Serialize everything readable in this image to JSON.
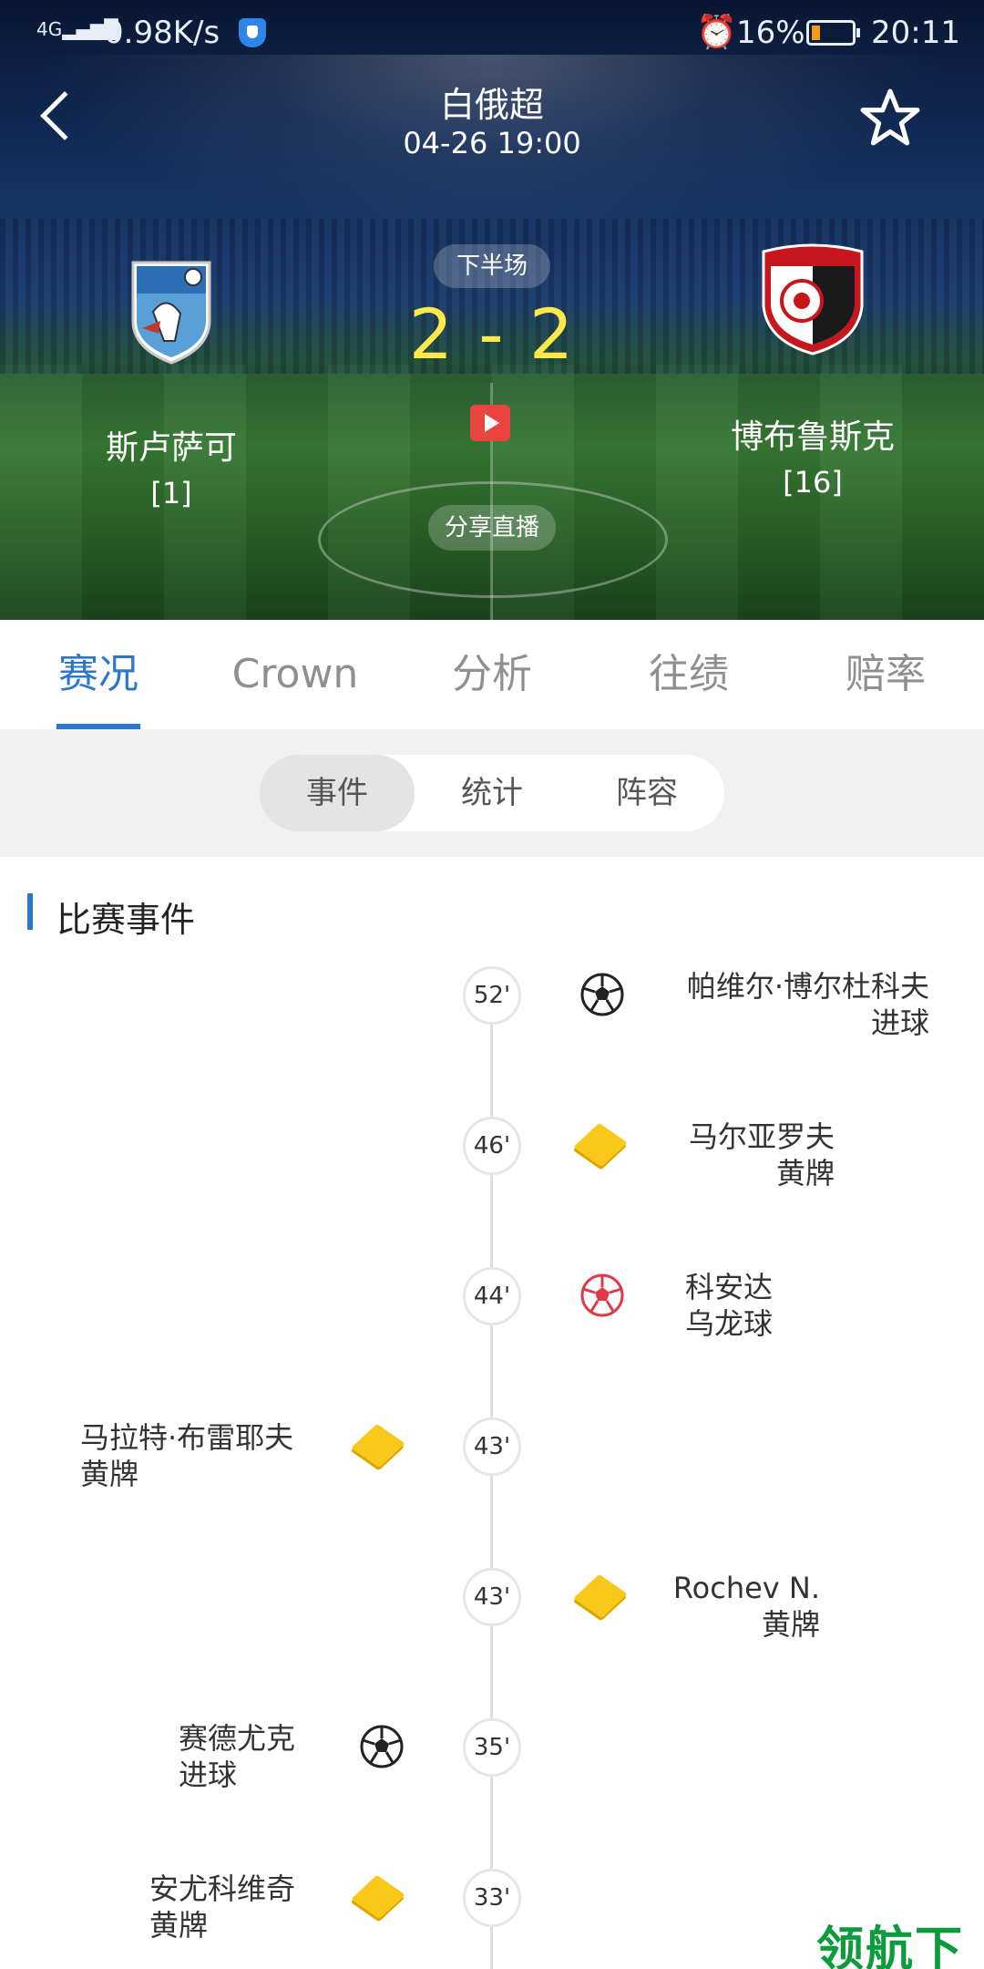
{
  "status_bar": {
    "signal": "4G",
    "speed": "0.98K/s",
    "battery": "16%",
    "time": "20:11"
  },
  "header": {
    "league": "白俄超",
    "datetime": "04-26 19:00",
    "period": "下半场",
    "score": "2 - 2",
    "share_label": "分享直播",
    "home": {
      "name": "斯卢萨可",
      "rank": "[1]"
    },
    "away": {
      "name": "博布鲁斯克",
      "rank": "[16]"
    }
  },
  "tabs": [
    "赛况",
    "Crown",
    "分析",
    "往绩",
    "赔率"
  ],
  "segments": [
    "事件",
    "统计",
    "阵容"
  ],
  "events_section": {
    "title": "比赛事件",
    "events": [
      {
        "minute": "52'",
        "side": "right",
        "type": "goal-icon",
        "player": "帕维尔·博尔杜科夫",
        "desc": "进球"
      },
      {
        "minute": "46'",
        "side": "right",
        "type": "yellow-card-icon",
        "player": "马尔亚罗夫",
        "desc": "黄牌"
      },
      {
        "minute": "44'",
        "side": "right",
        "type": "own-goal-icon",
        "player": "科安达",
        "desc": "乌龙球"
      },
      {
        "minute": "43'",
        "side": "left",
        "type": "yellow-card-icon",
        "player": "马拉特·布雷耶夫",
        "desc": "黄牌"
      },
      {
        "minute": "43'",
        "side": "right",
        "type": "yellow-card-icon",
        "player": "Rochev N.",
        "desc": "黄牌"
      },
      {
        "minute": "35'",
        "side": "left",
        "type": "goal-icon",
        "player": "赛德尤克",
        "desc": "进球"
      },
      {
        "minute": "33'",
        "side": "left",
        "type": "yellow-card-icon",
        "player": "安尤科维奇",
        "desc": "黄牌"
      }
    ]
  },
  "watermark": "领航下载",
  "colors": {
    "accent": "#2c77cc",
    "score": "#ffe84a",
    "yellow_card": "#f9c81a"
  }
}
